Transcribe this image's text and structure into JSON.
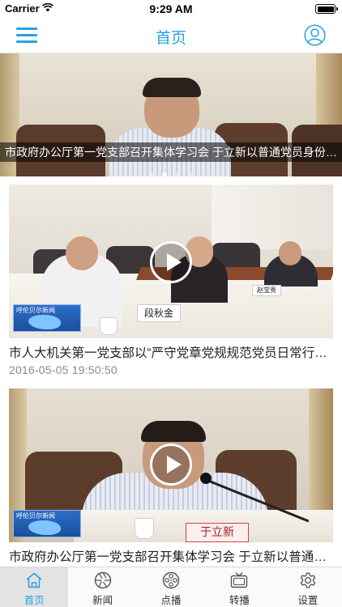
{
  "status_bar": {
    "carrier": "Carrier",
    "time": "9:29 AM",
    "battery_level": 1.0
  },
  "nav": {
    "title": "首页",
    "menu_icon": "hamburger-menu-icon",
    "user_icon": "user-profile-icon"
  },
  "colors": {
    "accent": "#2aa0e6",
    "tab_active_bg": "#e3e3e3",
    "timestamp": "#8a8a8a"
  },
  "carousel": {
    "caption": "市政府办公厅第一党支部召开集体学习会 于立新以普通党员身份参加",
    "page_count": 4,
    "active_page": 2
  },
  "news": [
    {
      "title": "市人大机关第一党支部以“严守党章党规规范党员日常行为”为主题开展学习讨论",
      "time": "2016-05-05 19:50:50",
      "station_logo": "呼伦贝尔新闻",
      "name_plate": "段秋金",
      "name_plate_2": "赵宝贵",
      "has_video": true
    },
    {
      "title": "市政府办公厅第一党支部召开集体学习会 于立新以普通党员身份参加",
      "station_logo": "呼伦贝尔新闻",
      "name_plate": "于立新",
      "has_video": true
    }
  ],
  "tabs": [
    {
      "label": "首页",
      "icon": "home-icon",
      "active": true
    },
    {
      "label": "新闻",
      "icon": "camera-aperture-icon",
      "active": false
    },
    {
      "label": "点播",
      "icon": "film-reel-icon",
      "active": false
    },
    {
      "label": "转播",
      "icon": "tv-icon",
      "active": false
    },
    {
      "label": "设置",
      "icon": "gear-icon",
      "active": false
    }
  ]
}
